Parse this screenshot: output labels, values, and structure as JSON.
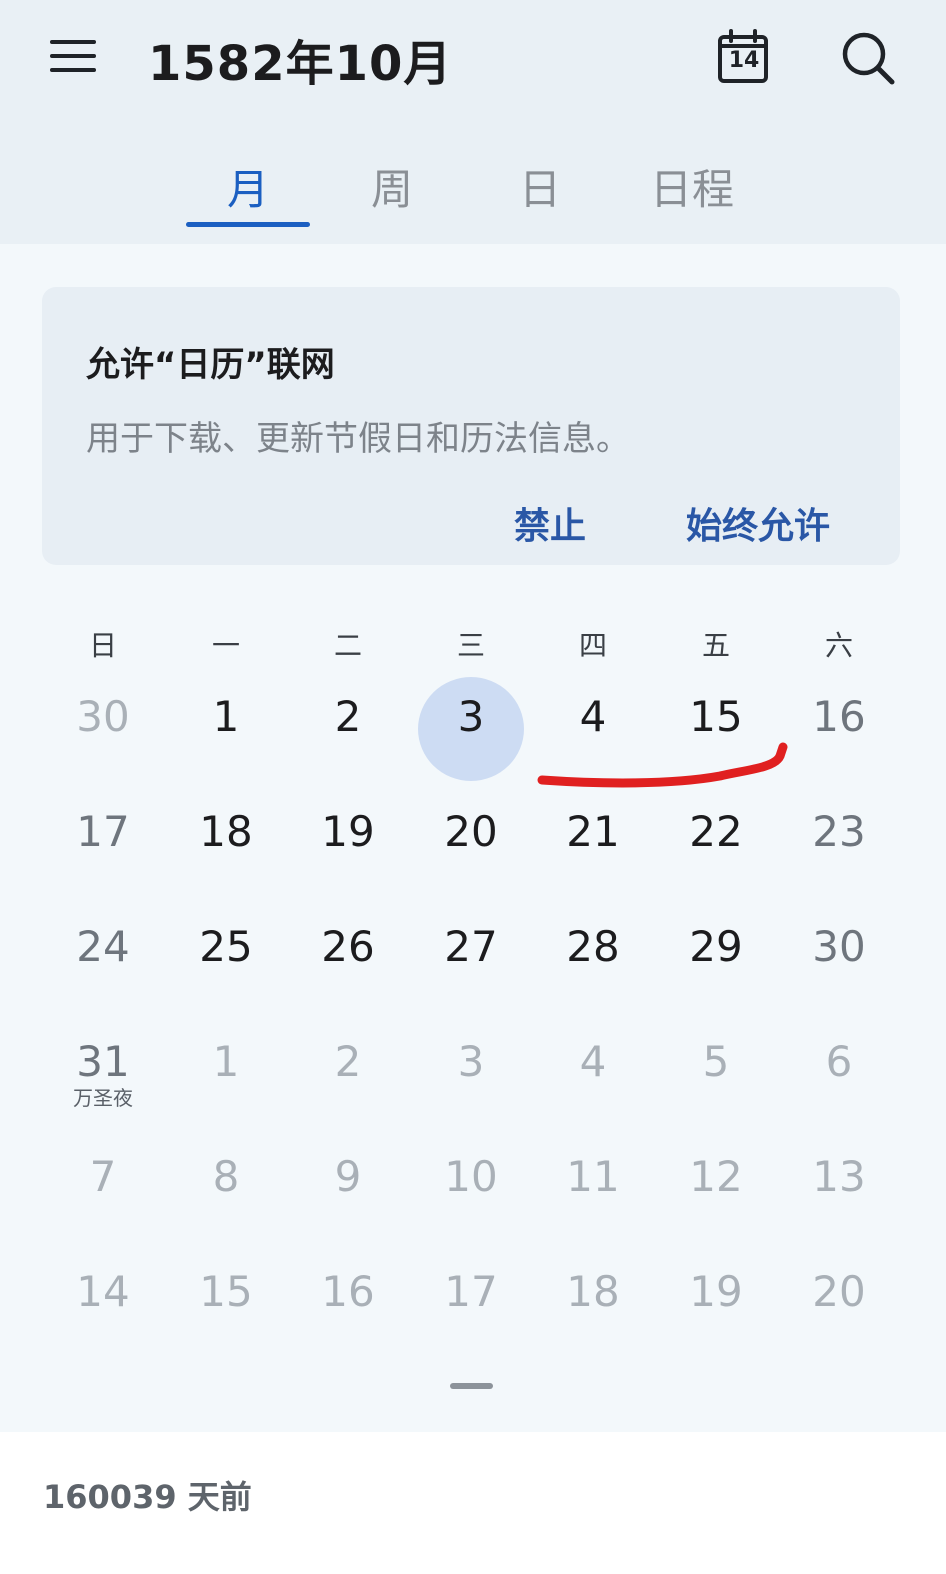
{
  "header": {
    "title": "1582年10月",
    "today_icon_number": "14",
    "menu_icon": "hamburger-menu-icon",
    "today_icon": "calendar-today-icon",
    "search_icon": "search-icon"
  },
  "tabs": [
    {
      "label": "月",
      "active": true
    },
    {
      "label": "周",
      "active": false
    },
    {
      "label": "日",
      "active": false
    },
    {
      "label": "日程",
      "active": false
    }
  ],
  "network_prompt": {
    "title": "允许“日历”联网",
    "description": "用于下载、更新节假日和历法信息。",
    "deny_label": "禁止",
    "allow_label": "始终允许"
  },
  "weekdays": [
    "日",
    "一",
    "二",
    "三",
    "四",
    "五",
    "六"
  ],
  "weeks": [
    [
      {
        "d": "30",
        "s": "other"
      },
      {
        "d": "1",
        "s": "cur"
      },
      {
        "d": "2",
        "s": "cur"
      },
      {
        "d": "3",
        "s": "selected"
      },
      {
        "d": "4",
        "s": "cur"
      },
      {
        "d": "15",
        "s": "cur"
      },
      {
        "d": "16",
        "s": "weekend"
      }
    ],
    [
      {
        "d": "17",
        "s": "weekend"
      },
      {
        "d": "18",
        "s": "cur"
      },
      {
        "d": "19",
        "s": "cur"
      },
      {
        "d": "20",
        "s": "cur"
      },
      {
        "d": "21",
        "s": "cur"
      },
      {
        "d": "22",
        "s": "cur"
      },
      {
        "d": "23",
        "s": "weekend"
      }
    ],
    [
      {
        "d": "24",
        "s": "weekend"
      },
      {
        "d": "25",
        "s": "cur"
      },
      {
        "d": "26",
        "s": "cur"
      },
      {
        "d": "27",
        "s": "cur"
      },
      {
        "d": "28",
        "s": "cur"
      },
      {
        "d": "29",
        "s": "cur"
      },
      {
        "d": "30",
        "s": "weekend"
      }
    ],
    [
      {
        "d": "31",
        "s": "weekend",
        "note": "万圣夜"
      },
      {
        "d": "1",
        "s": "other"
      },
      {
        "d": "2",
        "s": "other"
      },
      {
        "d": "3",
        "s": "other"
      },
      {
        "d": "4",
        "s": "other"
      },
      {
        "d": "5",
        "s": "other"
      },
      {
        "d": "6",
        "s": "other"
      }
    ],
    [
      {
        "d": "7",
        "s": "other"
      },
      {
        "d": "8",
        "s": "other"
      },
      {
        "d": "9",
        "s": "other"
      },
      {
        "d": "10",
        "s": "other"
      },
      {
        "d": "11",
        "s": "other"
      },
      {
        "d": "12",
        "s": "other"
      },
      {
        "d": "13",
        "s": "other"
      }
    ],
    [
      {
        "d": "14",
        "s": "other"
      },
      {
        "d": "15",
        "s": "other"
      },
      {
        "d": "16",
        "s": "other"
      },
      {
        "d": "17",
        "s": "other"
      },
      {
        "d": "18",
        "s": "other"
      },
      {
        "d": "19",
        "s": "other"
      },
      {
        "d": "20",
        "s": "other"
      }
    ]
  ],
  "footer": {
    "days_ago": "160039 天前"
  },
  "colors": {
    "accent": "#1b5fc1",
    "selected_circle": "#cddcf3",
    "annotation_red": "#e02020"
  }
}
